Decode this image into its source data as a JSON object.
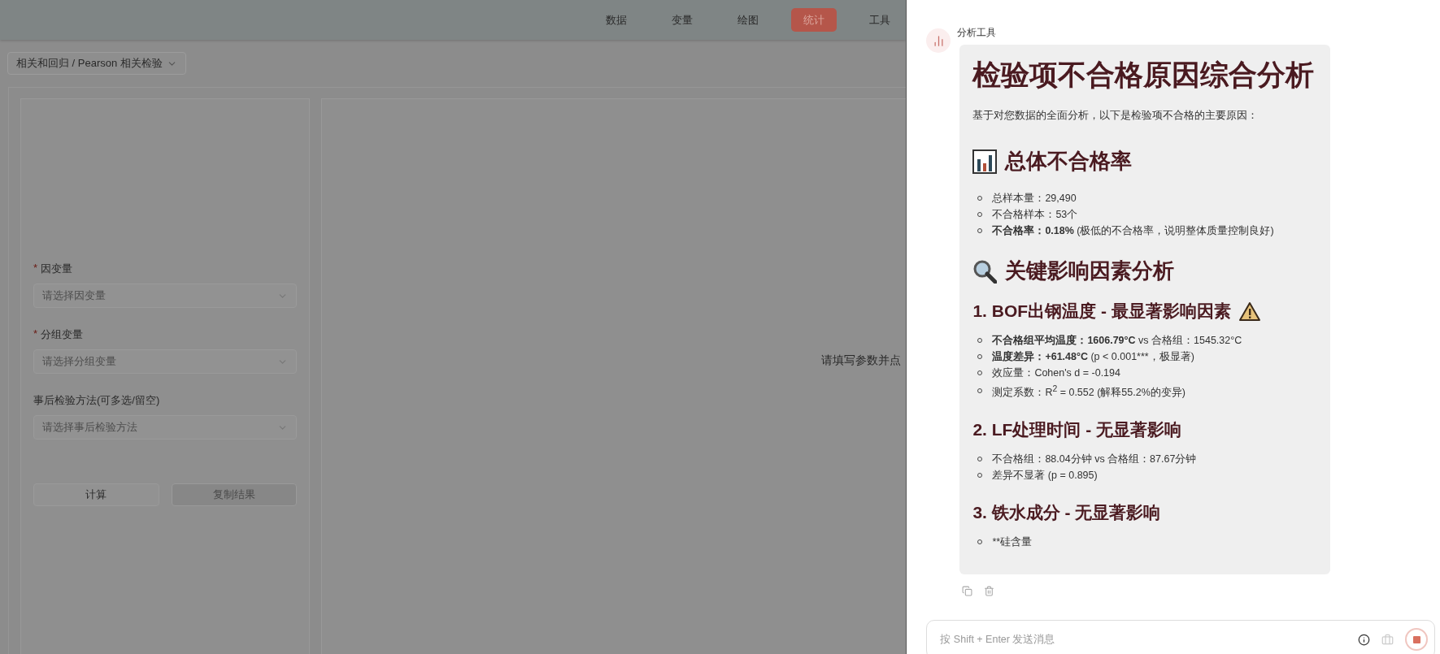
{
  "nav": [
    {
      "label": "数据",
      "selected": false
    },
    {
      "label": "变量",
      "selected": false
    },
    {
      "label": "绘图",
      "selected": false
    },
    {
      "label": "统计",
      "selected": true
    },
    {
      "label": "工具",
      "selected": false
    }
  ],
  "breadcrumb": "相关和回归 / Pearson 相关检验",
  "form": {
    "required_mark": "*",
    "fields": [
      {
        "label": "因变量",
        "required": true,
        "placeholder": "请选择因变量"
      },
      {
        "label": "分组变量",
        "required": true,
        "placeholder": "请选择分组变量"
      },
      {
        "label": "事后检验方法(可多选/留空)",
        "required": false,
        "placeholder": "请选择事后检验方法"
      }
    ],
    "buttons": [
      {
        "label": "计算",
        "disabled": false
      },
      {
        "label": "复制结果",
        "disabled": true
      }
    ]
  },
  "result_hint": "请填写参数并点",
  "drawer": {
    "sender": "分析工具",
    "message": [
      {
        "kind": "h1",
        "text": "检验项不合格原因综合分析"
      },
      {
        "kind": "p",
        "text": "基于对您数据的全面分析，以下是检验项不合格的主要原因："
      },
      {
        "kind": "h2",
        "text": "总体不合格率"
      },
      {
        "kind": "list",
        "items": [
          "总样本量：29,490",
          "不合格样本：53个",
          "**不合格率：0.18%** (极低的不合格率，说明整体质量控制良好)"
        ]
      },
      {
        "kind": "h2",
        "text": "关键影响因素分析"
      },
      {
        "kind": "h3",
        "text": "1. BOF出钢温度 - 最显著影响因素"
      },
      {
        "kind": "list",
        "items": [
          "**不合格组平均温度：1606.79°C** vs 合格组：1545.32°C",
          "**温度差异：+61.48°C** (p < 0.001***，极显著)",
          "效应量：Cohen's d = -0.194",
          "测定系数：R$^{2}$ = 0.552 (解释55.2%的变异)"
        ]
      },
      {
        "kind": "h3",
        "text": "2. LF处理时间 - 无显著影响"
      },
      {
        "kind": "list",
        "items": [
          "不合格组：88.04分钟 vs 合格组：87.67分钟",
          "差异不显著 (p = 0.895)"
        ]
      },
      {
        "kind": "h3",
        "text": "3. 铁水成分 - 无显著影响"
      },
      {
        "kind": "list",
        "items": [
          "**硅含量"
        ]
      }
    ],
    "input": {
      "placeholder": "按 Shift + Enter 发送消息"
    }
  }
}
